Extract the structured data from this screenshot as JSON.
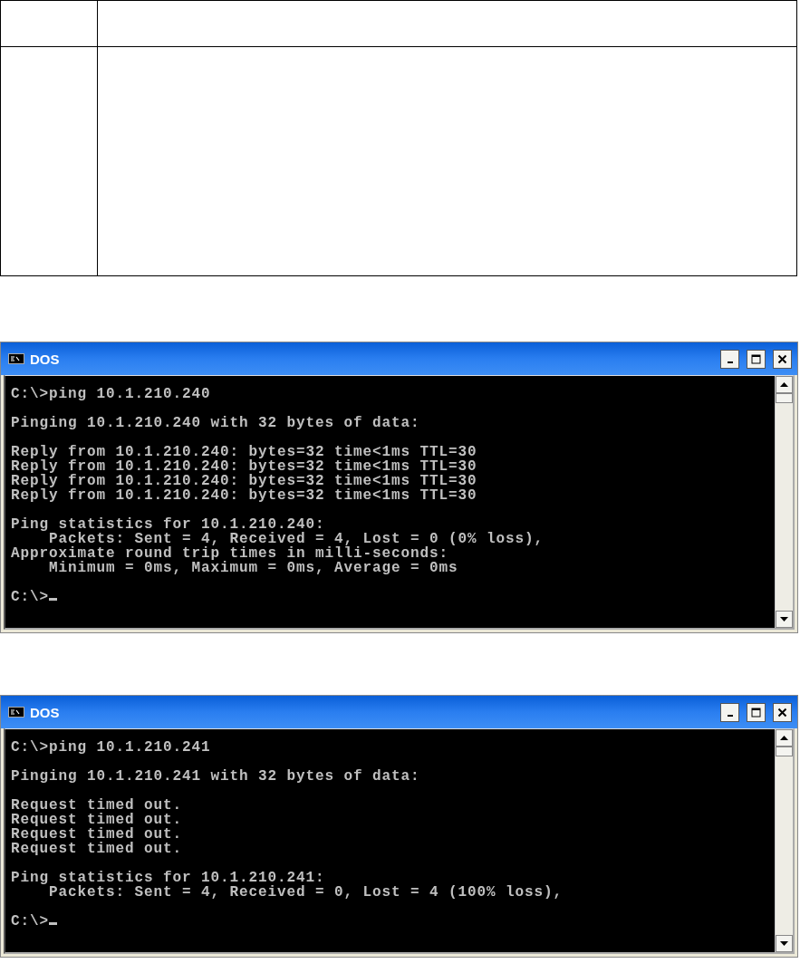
{
  "windows": [
    {
      "title": "DOS",
      "blocks": [
        [
          "C:\\>ping 10.1.210.240"
        ],
        [
          "Pinging 10.1.210.240 with 32 bytes of data:"
        ],
        [
          "Reply from 10.1.210.240: bytes=32 time<1ms TTL=30",
          "Reply from 10.1.210.240: bytes=32 time<1ms TTL=30",
          "Reply from 10.1.210.240: bytes=32 time<1ms TTL=30",
          "Reply from 10.1.210.240: bytes=32 time<1ms TTL=30"
        ],
        [
          "Ping statistics for 10.1.210.240:",
          "    Packets: Sent = 4, Received = 4, Lost = 0 (0% loss),",
          "Approximate round trip times in milli-seconds:",
          "    Minimum = 0ms, Maximum = 0ms, Average = 0ms"
        ],
        [
          "C:\\>"
        ]
      ]
    },
    {
      "title": "DOS",
      "blocks": [
        [
          "C:\\>ping 10.1.210.241"
        ],
        [
          "Pinging 10.1.210.241 with 32 bytes of data:"
        ],
        [
          "Request timed out.",
          "Request timed out.",
          "Request timed out.",
          "Request timed out."
        ],
        [
          "Ping statistics for 10.1.210.241:",
          "    Packets: Sent = 4, Received = 0, Lost = 4 (100% loss),"
        ],
        [
          "C:\\>"
        ]
      ]
    }
  ]
}
